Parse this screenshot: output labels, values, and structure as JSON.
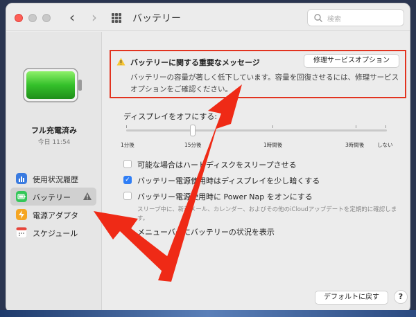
{
  "window": {
    "title": "バッテリー",
    "search_placeholder": "検索"
  },
  "sidebar": {
    "battery_status": "フル充電済み",
    "battery_time": "今日 11:54",
    "items": [
      {
        "label": "使用状況履歴",
        "icon": "usage-history-icon",
        "color": "#3a7be0"
      },
      {
        "label": "バッテリー",
        "icon": "battery-icon",
        "color": "#34c759",
        "active": true
      },
      {
        "label": "電源アダプタ",
        "icon": "power-adapter-icon",
        "color": "#f5a623"
      },
      {
        "label": "スケジュール",
        "icon": "schedule-icon",
        "color": "#ffffff"
      }
    ]
  },
  "alert": {
    "title": "バッテリーに関する重要なメッセージ",
    "button": "修理サービスオプション",
    "body": "バッテリーの容量が著しく低下しています。容量を回復させるには、修理サービスオプションをご確認ください。"
  },
  "display_off": {
    "label": "ディスプレイをオフにする:",
    "ticks": [
      "1分後",
      "15分後",
      "1時間後",
      "3時間後",
      "しない"
    ]
  },
  "options": [
    {
      "label": "可能な場合はハードディスクをスリープさせる",
      "checked": false
    },
    {
      "label": "バッテリー電源使用時はディスプレイを少し暗くする",
      "checked": true
    },
    {
      "label": "バッテリー電源使用時に Power Nap をオンにする",
      "checked": false
    },
    {
      "label": "メニューバーにバッテリーの状況を表示",
      "checked": false
    }
  ],
  "help_text": "スリープ中に、新着メール、カレンダー、およびその他のiCloudアップデートを定期的に確認します。",
  "footer": {
    "default_button": "デフォルトに戻す",
    "help_button": "?"
  },
  "colors": {
    "highlight_red": "#e2331f",
    "battery_green": "#34c759",
    "accent_blue": "#2f7ef6"
  }
}
